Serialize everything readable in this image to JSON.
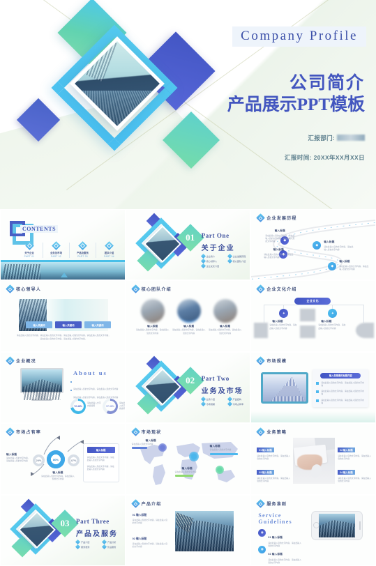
{
  "hero": {
    "eyebrow": "Company Profile",
    "title_line1": "公司简介",
    "title_line2": "产品展示PPT模板",
    "meta_department_label": "汇报部门:",
    "meta_date": "汇报时间: 20XX年XX月XX日"
  },
  "colors": {
    "brand_blue": "#4356c4",
    "brand_cyan": "#4dc0ee",
    "brand_green": "#6fd7b0",
    "title_purple": "#4356bf",
    "text_dark": "#3a4d9a"
  },
  "slides": [
    {
      "id": "contents",
      "title": "CONTENTS",
      "word": "CONTENTS",
      "items": [
        {
          "label": "关于企业",
          "part": "PART 01"
        },
        {
          "label": "业务及市场",
          "part": "PART 02"
        },
        {
          "label": "产品及服务",
          "part": "PART 03"
        },
        {
          "label": "团队介绍",
          "part": "PART 04"
        }
      ]
    },
    {
      "id": "section-one",
      "number": "01",
      "en": "Part One",
      "cn": "关于企业",
      "bullets": [
        "企业简介",
        "企业发展历程",
        "核心领导人",
        "核心团队介绍",
        "企业文化介绍"
      ]
    },
    {
      "id": "history",
      "title": "企业发展历程",
      "nodes": [
        {
          "label": "输入标题",
          "text": "请在此输入您的文字内容，请在此输入您的文字内容，请在此输入您的文字内容"
        },
        {
          "label": "输入标题",
          "text": "请在此输入您的文字内容，请在此输入您的文字内容"
        },
        {
          "label": "输入标题",
          "text": "请在此输入您的文字内容，请在此输入您的文字内容"
        },
        {
          "label": "输入标题",
          "text": "请在此输入您的文字内容，请在此输入您的文字内容"
        }
      ]
    },
    {
      "id": "leaders",
      "title": "核心领导人",
      "tabs": [
        "输入关键词",
        "输入关键词",
        "输入关键词"
      ],
      "body": "请在此输入您的文字内容，请在此输入您的文字内容，请在此输入您的文字内容，请在此输入您的文字内容，请在此输入您的文字内容，请在此输入您的文字内容。"
    },
    {
      "id": "team",
      "title": "核心团队介绍",
      "members": [
        {
          "name": "输入标题",
          "desc": "请在此输入您的文字内容，请在此输入您的文字内容"
        },
        {
          "name": "输入标题",
          "desc": "请在此输入您的文字内容，请在此输入您的文字内容"
        },
        {
          "name": "输入标题",
          "desc": "请在此输入您的文字内容，请在此输入您的文字内容"
        }
      ]
    },
    {
      "id": "culture",
      "title": "企业文化介绍",
      "center_pill": "企业文化",
      "branches": [
        {
          "label": "输入标题",
          "desc": "请在此输入您的文字内容，请在此输入您的文字内容"
        },
        {
          "label": "输入标题",
          "desc": "请在此输入您的文字内容，请在此输入您的文字内容"
        }
      ]
    },
    {
      "id": "about",
      "title": "企业概况",
      "heading": "About us",
      "bullets": [
        "请在此输入您的文字内容，请在此输入您的文字内容",
        "请在此输入您的文字内容，请在此输入您的文字内容"
      ],
      "stats": [
        {
          "value": "72.46%",
          "label": "请在此输入文字内容说明"
        },
        {
          "value": "57.38%",
          "label": "请在此输入文字内容说明"
        }
      ]
    },
    {
      "id": "section-two",
      "number": "02",
      "en": "Part Two",
      "cn": "业务及市场",
      "bullets": [
        "业务介绍",
        "产品结构",
        "市场规模",
        "市场占有率"
      ]
    },
    {
      "id": "market-size",
      "title": "市场规模",
      "panel_header": "输入您想要的标题内容",
      "points": [
        "请在此输入您的文字内容，请在此输入您的文字内容",
        "请在此输入您的文字内容，请在此输入您的文字内容",
        "请在此输入您的文字内容，请在此输入您的文字内容"
      ]
    },
    {
      "id": "market-share",
      "title": "市场占有率",
      "center_value": "80%",
      "side_values": [
        "20%",
        "47%"
      ],
      "left_label": "输入标题",
      "left_text": "请在此输入您的文字内容，请在此输入您的文字内容",
      "bottom_label": "输入标题",
      "bottom_text": "请在此输入您的文字内容，请在此输入您的文字内容",
      "panel_header": "输入标题",
      "panel_points": [
        "请在此输入您的文字内容，请在此输入您的文字内容",
        "请在此输入您的文字内容，请在此输入您的文字内容"
      ]
    },
    {
      "id": "market-status",
      "title": "市场现状",
      "regions": [
        {
          "label": "输入标题",
          "desc": "请在此输入您的文字内容"
        },
        {
          "label": "输入标题",
          "desc": "请在此输入您的文字内容"
        },
        {
          "label": "输入标题",
          "desc": "请在此输入您的文字内容"
        }
      ]
    },
    {
      "id": "strategy",
      "title": "业务策略",
      "items": [
        {
          "no": "01",
          "label": "输入标题",
          "desc": "请在此输入您的文字内容，请在此输入您的文字内容"
        },
        {
          "no": "02",
          "label": "输入标题",
          "desc": "请在此输入您的文字内容，请在此输入您的文字内容"
        },
        {
          "no": "03",
          "label": "输入标题",
          "desc": "请在此输入您的文字内容，请在此输入您的文字内容"
        },
        {
          "no": "04",
          "label": "输入标题",
          "desc": "请在此输入您的文字内容，请在此输入您的文字内容"
        }
      ]
    },
    {
      "id": "section-three",
      "number": "03",
      "en": "Part Three",
      "cn": "产品及服务",
      "bullets": [
        "产品介绍",
        "产品分析",
        "服务准则",
        "售后服务"
      ]
    },
    {
      "id": "product",
      "title": "产品介绍",
      "blocks": [
        {
          "no": "01",
          "label": "输入标题",
          "desc": "请在此输入您的文字内容，请在此输入您的文字内容"
        },
        {
          "no": "02",
          "label": "输入标题",
          "desc": "请在此输入您的文字内容，请在此输入您的文字内容"
        }
      ]
    },
    {
      "id": "service",
      "title": "服务准则",
      "heading_line1": "Service",
      "heading_line2": "Guidelines",
      "items": [
        {
          "no": "01",
          "label": "输入标题",
          "desc": "请在此输入您的文字内容，请在此输入您的文字内容"
        },
        {
          "no": "02",
          "label": "输入标题",
          "desc": "请在此输入您的文字内容，请在此输入您的文字内容"
        }
      ]
    }
  ]
}
